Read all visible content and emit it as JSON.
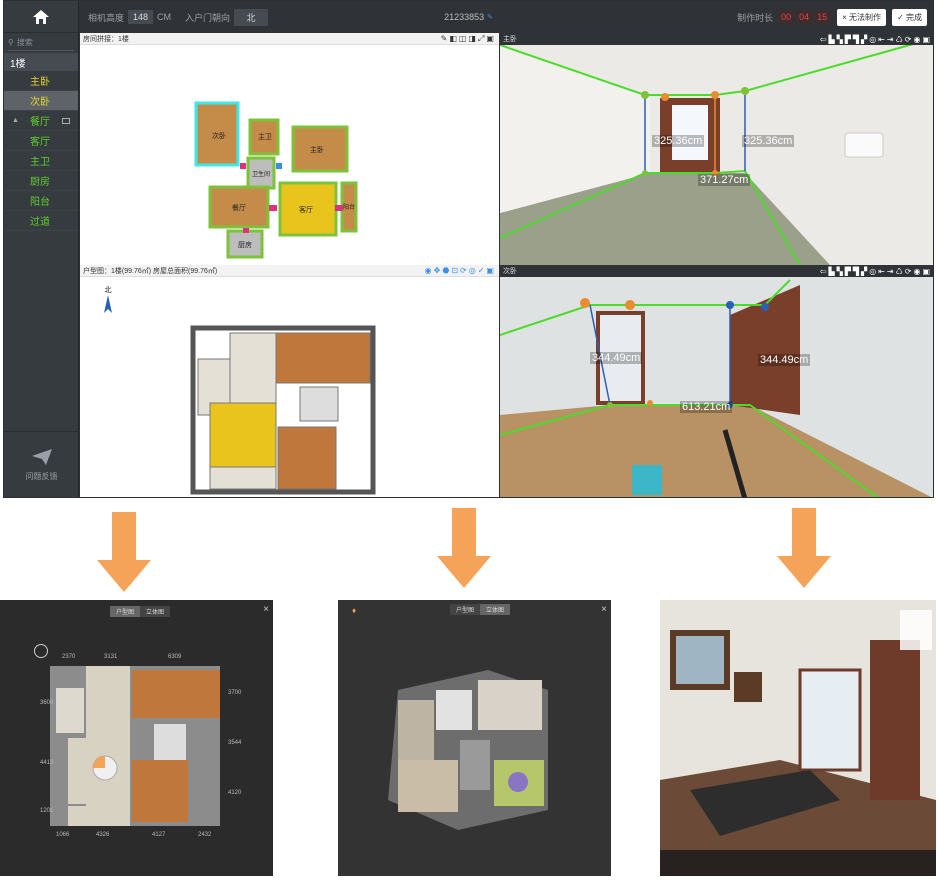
{
  "toolbar": {
    "camera_height_label": "相机高度",
    "camera_height_value": "148",
    "camera_height_unit": "CM",
    "entrance_label": "入户门朝向",
    "entrance_value": "北",
    "project_id": "21233853",
    "time_label": "制作时长",
    "time_h": "00",
    "time_m": "04",
    "time_s": "15",
    "cannot_btn": "× 无法制作",
    "done_btn": "✓ 完成"
  },
  "sidebar": {
    "search_placeholder": "搜索",
    "floor": "1楼",
    "rooms": [
      "主卧",
      "次卧",
      "餐厅",
      "客厅",
      "主卫",
      "厨房",
      "阳台",
      "过道"
    ],
    "feedback": "问题反馈"
  },
  "layout_panel": {
    "title": "房间拼接：1楼",
    "rooms": [
      "次卧",
      "主卫",
      "卫生间",
      "主卧",
      "餐厅",
      "客厅",
      "阳台",
      "厨房"
    ]
  },
  "floorplan_panel": {
    "title": "户型图：1楼(99.76㎡) 房屋总面积(99.76㎡)",
    "compass": "北"
  },
  "view1": {
    "title": "主卧",
    "dims": [
      "325.36cm",
      "325.36cm",
      "371.27cm"
    ]
  },
  "view2": {
    "title": "次卧",
    "dims": [
      "344.49cm",
      "344.49cm",
      "613.21cm"
    ]
  },
  "preview1": {
    "tabs": [
      "户型图",
      "立体图"
    ],
    "dims_top": [
      "2370",
      "3131",
      "6309"
    ],
    "dims_bottom": [
      "1066",
      "4326",
      "4127",
      "2432"
    ],
    "dims_left": [
      "3600",
      "4413",
      "1201"
    ],
    "dims_right": [
      "3700",
      "3544",
      "4120"
    ]
  },
  "preview2": {
    "tabs": [
      "户型图",
      "立体图"
    ]
  },
  "colors": {
    "accent_green": "#5fce2d",
    "accent_yellow": "#e8d22a",
    "timer_red": "#e24444",
    "arrow_orange": "#f6a35a"
  }
}
